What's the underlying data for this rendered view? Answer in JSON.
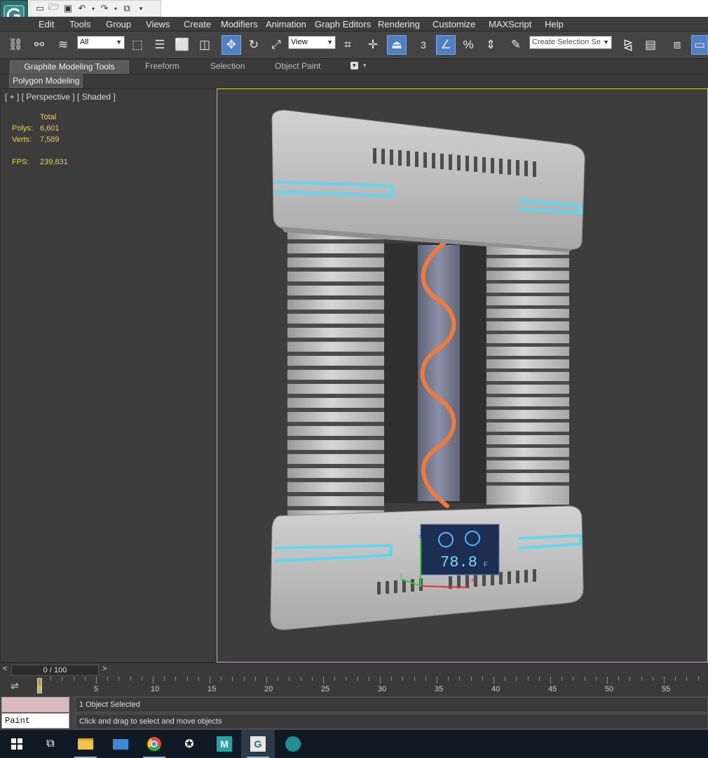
{
  "menu": {
    "items": [
      "Edit",
      "Tools",
      "Group",
      "Views",
      "Create",
      "Modifiers",
      "Animation",
      "Graph Editors",
      "Rendering",
      "Customize",
      "MAXScript",
      "Help"
    ]
  },
  "toolbar": {
    "selection_filter": "All",
    "reference_coord": "View",
    "named_selection_placeholder": "Create Selection Se",
    "snap_label": "3"
  },
  "ribbon": {
    "tabs": [
      "Graphite Modeling Tools",
      "Freeform",
      "Selection",
      "Object Paint"
    ],
    "active_panel": "Polygon Modeling"
  },
  "viewport": {
    "label": "[ + ] [ Perspective ] [ Shaded ]",
    "stats": {
      "header": "Total",
      "polys_label": "Polys:",
      "polys_value": "6,601",
      "verts_label": "Verts:",
      "verts_value": "7,589",
      "fps_label": "FPS:",
      "fps_value": "239,831"
    },
    "display_readout": "78.8",
    "display_unit": "F",
    "gizmo": {
      "x": "x",
      "y": "y",
      "z": "z"
    }
  },
  "timeline": {
    "slider_text": "0 / 100",
    "prev": "<",
    "next": ">",
    "ruler_labels": [
      "0",
      "5",
      "10",
      "15",
      "20",
      "25",
      "30",
      "35",
      "40",
      "45",
      "50",
      "55"
    ]
  },
  "status": {
    "paint_label": "Paint",
    "selection_text": "1 Object Selected",
    "prompt_text": "Click and drag to select and move objects"
  },
  "colors": {
    "accent_glow": "#62d6f0",
    "coil": "#f07a3a",
    "viewport_border": "#d8c63a",
    "stats_text": "#e8d24a"
  }
}
